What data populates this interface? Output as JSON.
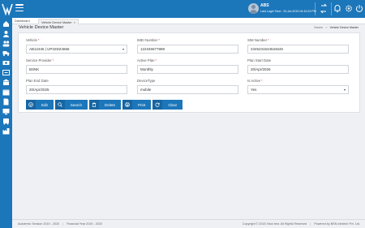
{
  "header": {
    "user_name": "ABS",
    "last_login_label": "Last Login Time : ",
    "last_login_time": "20-Jul-2019 04:10:23 PM"
  },
  "tabs": [
    {
      "label": "Dashboard"
    },
    {
      "label": "Vehicle Device Master",
      "close": "×"
    }
  ],
  "page": {
    "title": "Vehicle Device Master",
    "breadcrumb": [
      "Master",
      "Vehicle Device Master"
    ],
    "breadcrumb_sep": ">"
  },
  "form": {
    "vehicle": {
      "label": "Vehicle",
      "value": "AB12345 | UP32DZ4666"
    },
    "imei": {
      "label": "IMEI Number",
      "value": "122345677889"
    },
    "sim": {
      "label": "SIM Number",
      "value": "2345231534534645"
    },
    "provider": {
      "label": "Service Provider",
      "value": "BSNK"
    },
    "active_plan": {
      "label": "Active Plan",
      "value": "Monthly"
    },
    "plan_start": {
      "label": "Plan Start Date",
      "value": "20/Apr/2026"
    },
    "plan_end": {
      "label": "Plan End Date",
      "value": "20/Apr/2025"
    },
    "device_type": {
      "label": "DeviceType",
      "value": "mobile"
    },
    "is_active": {
      "label": "Is Active",
      "value": "Yes"
    },
    "required_mark": "*"
  },
  "actions": {
    "edit": "Edit",
    "search": "Search",
    "delete": "Delete",
    "print": "Print",
    "clear": "Clear"
  },
  "footer": {
    "academic_session": "Academic Session 2019 - 2020",
    "financial_year": "Financial Year 2019 - 2020",
    "separator": "|",
    "copyright": "Copyright © 2018 Vdox test. All Rights Reserved",
    "powered": "Powered by BSN Infotech Pvt. Ltd."
  },
  "colors": {
    "brand": "#1c76ba",
    "button_icon_bg": "#1766a2",
    "required": "#e24a4a"
  }
}
